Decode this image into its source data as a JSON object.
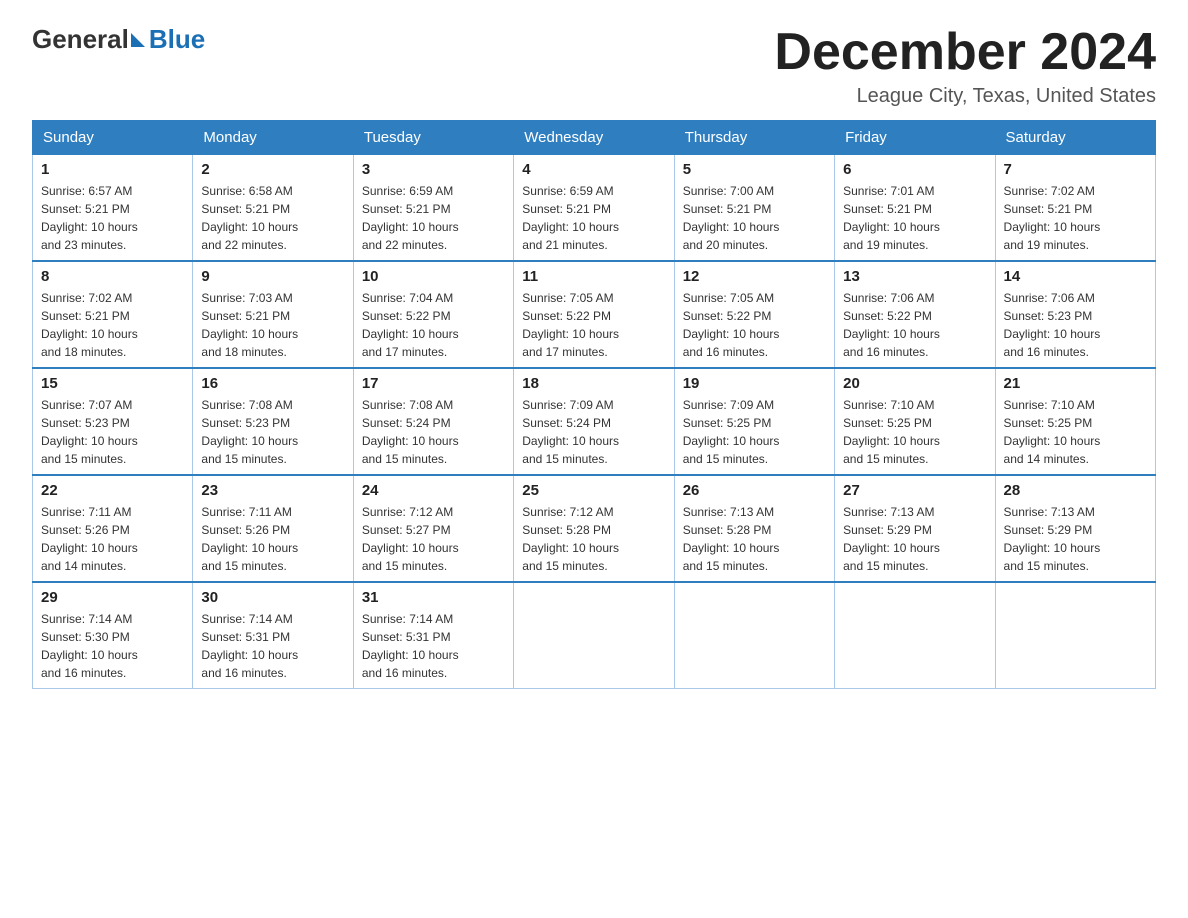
{
  "logo": {
    "general": "General",
    "blue": "Blue"
  },
  "header": {
    "month": "December 2024",
    "location": "League City, Texas, United States"
  },
  "weekdays": [
    "Sunday",
    "Monday",
    "Tuesday",
    "Wednesday",
    "Thursday",
    "Friday",
    "Saturday"
  ],
  "weeks": [
    [
      {
        "day": "1",
        "sunrise": "6:57 AM",
        "sunset": "5:21 PM",
        "daylight": "10 hours and 23 minutes."
      },
      {
        "day": "2",
        "sunrise": "6:58 AM",
        "sunset": "5:21 PM",
        "daylight": "10 hours and 22 minutes."
      },
      {
        "day": "3",
        "sunrise": "6:59 AM",
        "sunset": "5:21 PM",
        "daylight": "10 hours and 22 minutes."
      },
      {
        "day": "4",
        "sunrise": "6:59 AM",
        "sunset": "5:21 PM",
        "daylight": "10 hours and 21 minutes."
      },
      {
        "day": "5",
        "sunrise": "7:00 AM",
        "sunset": "5:21 PM",
        "daylight": "10 hours and 20 minutes."
      },
      {
        "day": "6",
        "sunrise": "7:01 AM",
        "sunset": "5:21 PM",
        "daylight": "10 hours and 19 minutes."
      },
      {
        "day": "7",
        "sunrise": "7:02 AM",
        "sunset": "5:21 PM",
        "daylight": "10 hours and 19 minutes."
      }
    ],
    [
      {
        "day": "8",
        "sunrise": "7:02 AM",
        "sunset": "5:21 PM",
        "daylight": "10 hours and 18 minutes."
      },
      {
        "day": "9",
        "sunrise": "7:03 AM",
        "sunset": "5:21 PM",
        "daylight": "10 hours and 18 minutes."
      },
      {
        "day": "10",
        "sunrise": "7:04 AM",
        "sunset": "5:22 PM",
        "daylight": "10 hours and 17 minutes."
      },
      {
        "day": "11",
        "sunrise": "7:05 AM",
        "sunset": "5:22 PM",
        "daylight": "10 hours and 17 minutes."
      },
      {
        "day": "12",
        "sunrise": "7:05 AM",
        "sunset": "5:22 PM",
        "daylight": "10 hours and 16 minutes."
      },
      {
        "day": "13",
        "sunrise": "7:06 AM",
        "sunset": "5:22 PM",
        "daylight": "10 hours and 16 minutes."
      },
      {
        "day": "14",
        "sunrise": "7:06 AM",
        "sunset": "5:23 PM",
        "daylight": "10 hours and 16 minutes."
      }
    ],
    [
      {
        "day": "15",
        "sunrise": "7:07 AM",
        "sunset": "5:23 PM",
        "daylight": "10 hours and 15 minutes."
      },
      {
        "day": "16",
        "sunrise": "7:08 AM",
        "sunset": "5:23 PM",
        "daylight": "10 hours and 15 minutes."
      },
      {
        "day": "17",
        "sunrise": "7:08 AM",
        "sunset": "5:24 PM",
        "daylight": "10 hours and 15 minutes."
      },
      {
        "day": "18",
        "sunrise": "7:09 AM",
        "sunset": "5:24 PM",
        "daylight": "10 hours and 15 minutes."
      },
      {
        "day": "19",
        "sunrise": "7:09 AM",
        "sunset": "5:25 PM",
        "daylight": "10 hours and 15 minutes."
      },
      {
        "day": "20",
        "sunrise": "7:10 AM",
        "sunset": "5:25 PM",
        "daylight": "10 hours and 15 minutes."
      },
      {
        "day": "21",
        "sunrise": "7:10 AM",
        "sunset": "5:25 PM",
        "daylight": "10 hours and 14 minutes."
      }
    ],
    [
      {
        "day": "22",
        "sunrise": "7:11 AM",
        "sunset": "5:26 PM",
        "daylight": "10 hours and 14 minutes."
      },
      {
        "day": "23",
        "sunrise": "7:11 AM",
        "sunset": "5:26 PM",
        "daylight": "10 hours and 15 minutes."
      },
      {
        "day": "24",
        "sunrise": "7:12 AM",
        "sunset": "5:27 PM",
        "daylight": "10 hours and 15 minutes."
      },
      {
        "day": "25",
        "sunrise": "7:12 AM",
        "sunset": "5:28 PM",
        "daylight": "10 hours and 15 minutes."
      },
      {
        "day": "26",
        "sunrise": "7:13 AM",
        "sunset": "5:28 PM",
        "daylight": "10 hours and 15 minutes."
      },
      {
        "day": "27",
        "sunrise": "7:13 AM",
        "sunset": "5:29 PM",
        "daylight": "10 hours and 15 minutes."
      },
      {
        "day": "28",
        "sunrise": "7:13 AM",
        "sunset": "5:29 PM",
        "daylight": "10 hours and 15 minutes."
      }
    ],
    [
      {
        "day": "29",
        "sunrise": "7:14 AM",
        "sunset": "5:30 PM",
        "daylight": "10 hours and 16 minutes."
      },
      {
        "day": "30",
        "sunrise": "7:14 AM",
        "sunset": "5:31 PM",
        "daylight": "10 hours and 16 minutes."
      },
      {
        "day": "31",
        "sunrise": "7:14 AM",
        "sunset": "5:31 PM",
        "daylight": "10 hours and 16 minutes."
      },
      null,
      null,
      null,
      null
    ]
  ],
  "labels": {
    "sunrise": "Sunrise:",
    "sunset": "Sunset:",
    "daylight": "Daylight:"
  }
}
